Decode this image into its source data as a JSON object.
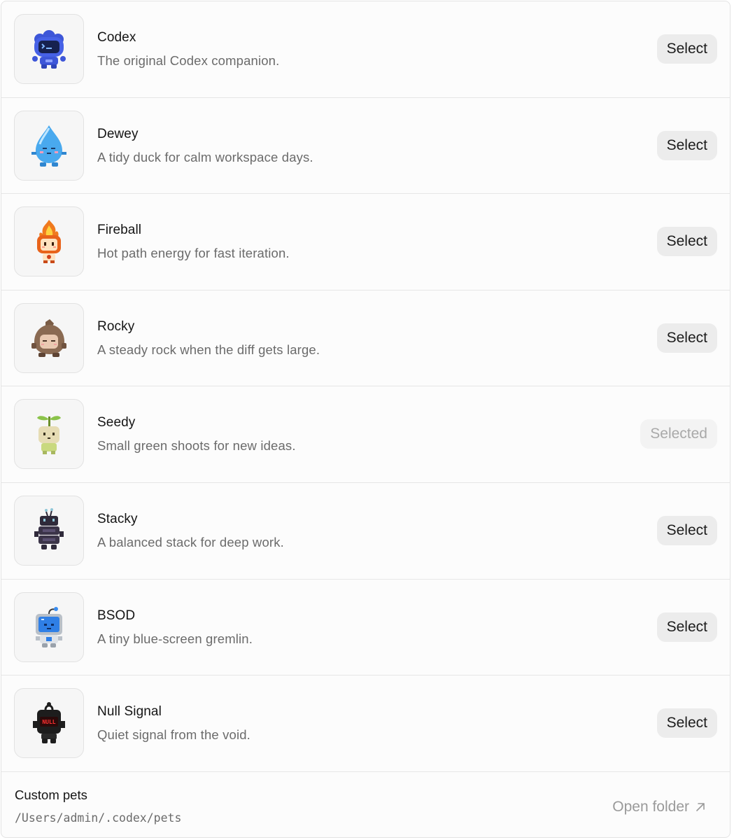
{
  "pets": [
    {
      "name": "Codex",
      "description": "The original Codex companion.",
      "button": "Select",
      "selected": false,
      "icon": "codex-pet-icon"
    },
    {
      "name": "Dewey",
      "description": "A tidy duck for calm workspace days.",
      "button": "Select",
      "selected": false,
      "icon": "dewey-pet-icon"
    },
    {
      "name": "Fireball",
      "description": "Hot path energy for fast iteration.",
      "button": "Select",
      "selected": false,
      "icon": "fireball-pet-icon"
    },
    {
      "name": "Rocky",
      "description": "A steady rock when the diff gets large.",
      "button": "Select",
      "selected": false,
      "icon": "rocky-pet-icon"
    },
    {
      "name": "Seedy",
      "description": "Small green shoots for new ideas.",
      "button": "Selected",
      "selected": true,
      "icon": "seedy-pet-icon"
    },
    {
      "name": "Stacky",
      "description": "A balanced stack for deep work.",
      "button": "Select",
      "selected": false,
      "icon": "stacky-pet-icon"
    },
    {
      "name": "BSOD",
      "description": "A tiny blue-screen gremlin.",
      "button": "Select",
      "selected": false,
      "icon": "bsod-pet-icon"
    },
    {
      "name": "Null Signal",
      "description": "Quiet signal from the void.",
      "button": "Select",
      "selected": false,
      "icon": "null-signal-pet-icon",
      "badge_text": "NULL"
    }
  ],
  "footer": {
    "title": "Custom pets",
    "path": "/Users/admin/.codex/pets",
    "open_folder_label": "Open folder",
    "open_folder_icon": "arrow-up-right-icon"
  }
}
